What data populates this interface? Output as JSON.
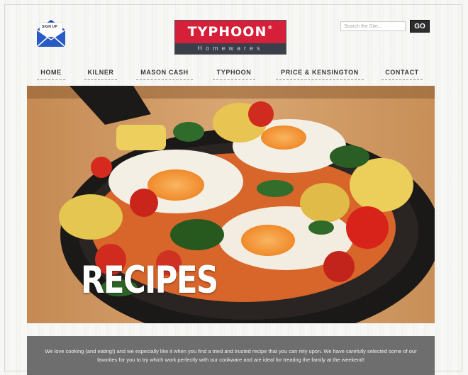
{
  "signup": {
    "label": "SIGN UP",
    "icon": "envelope-icon"
  },
  "logo": {
    "top": "TYPHOON",
    "reg": "®",
    "bottom": "Homewares"
  },
  "search": {
    "placeholder": "Search the Site...",
    "go_label": "GO"
  },
  "nav": {
    "items": [
      "HOME",
      "KILNER",
      "MASON CASH",
      "TYPHOON",
      "PRICE & KENSINGTON",
      "CONTACT"
    ]
  },
  "hero": {
    "title": "RECIPES"
  },
  "intro": {
    "text": "We love cooking (and eating!) and we especially like it when you find a tried and trusted recipe that you can rely upon. We have carefully selected some of our favorites for you to try which work perfectly with our cookware and are ideal for treating the family at the weekend!"
  },
  "colors": {
    "brand_red": "#d6203a",
    "brand_dark": "#3b3f4a",
    "intro_bg": "#6e6e6e"
  }
}
